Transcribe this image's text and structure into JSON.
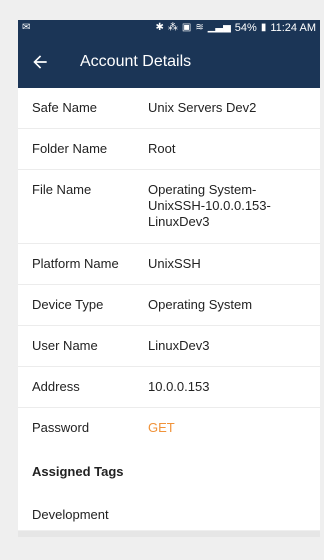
{
  "status_bar": {
    "left_icon": "email-icon",
    "battery": "54%",
    "time": "11:24 AM"
  },
  "header": {
    "title": "Account Details",
    "back_icon": "arrow-left-icon",
    "color": "#1b3556"
  },
  "details": [
    {
      "label": "Safe Name",
      "value": "Unix Servers Dev2"
    },
    {
      "label": "Folder Name",
      "value": "Root"
    },
    {
      "label": "File Name",
      "value": "Operating System-\nUnixSSH-10.0.0.153-\nLinuxDev3"
    },
    {
      "label": "Platform Name",
      "value": "UnixSSH"
    },
    {
      "label": "Device Type",
      "value": "Operating System"
    },
    {
      "label": "User Name",
      "value": "LinuxDev3"
    },
    {
      "label": "Address",
      "value": "10.0.0.153"
    },
    {
      "label": "Password",
      "value": "GET"
    }
  ],
  "tags": {
    "title": "Assigned Tags",
    "items": [
      "Development"
    ]
  },
  "accent_color": "#f0933a"
}
